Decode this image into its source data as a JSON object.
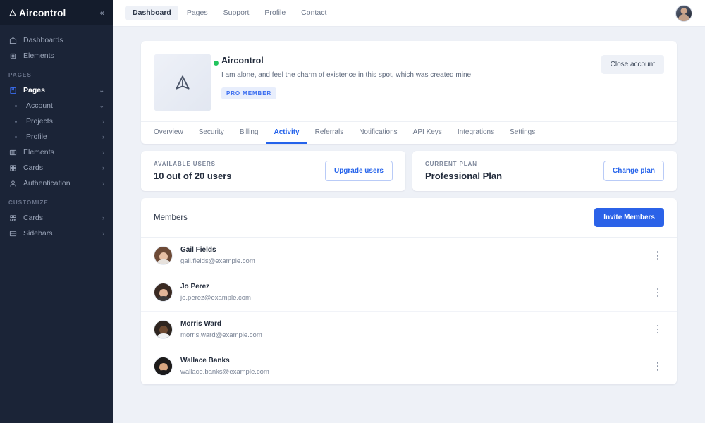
{
  "sidebar": {
    "brand": "Aircontrol",
    "collapse_icon": "chevron-double-left-icon",
    "top_items": [
      {
        "label": "Dashboards",
        "icon": "home-icon"
      },
      {
        "label": "Elements",
        "icon": "chip-icon"
      }
    ],
    "pages_section": "PAGES",
    "pages_items": [
      {
        "label": "Pages",
        "icon": "book-icon",
        "chevron": "⌄",
        "active": true,
        "sub": false
      },
      {
        "label": "Account",
        "icon": "bullet-dot",
        "chevron": "⌄",
        "active": false,
        "sub": true
      },
      {
        "label": "Projects",
        "icon": "bullet-dot",
        "chevron": "›",
        "active": false,
        "sub": true
      },
      {
        "label": "Profile",
        "icon": "bullet-dot",
        "chevron": "›",
        "active": false,
        "sub": true
      },
      {
        "label": "Elements",
        "icon": "columns-icon",
        "chevron": "›",
        "active": false,
        "sub": false
      },
      {
        "label": "Cards",
        "icon": "grid-icon",
        "chevron": "›",
        "active": false,
        "sub": false
      },
      {
        "label": "Authentication",
        "icon": "user-icon",
        "chevron": "›",
        "active": false,
        "sub": false
      }
    ],
    "customize_section": "CUSTOMIZE",
    "customize_items": [
      {
        "label": "Cards",
        "icon": "grid-plus-icon",
        "chevron": "›"
      },
      {
        "label": "Sidebars",
        "icon": "sidebar-icon",
        "chevron": "›"
      }
    ]
  },
  "topbar": {
    "nav": [
      {
        "label": "Dashboard",
        "active": true
      },
      {
        "label": "Pages",
        "active": false
      },
      {
        "label": "Support",
        "active": false
      },
      {
        "label": "Profile",
        "active": false
      },
      {
        "label": "Contact",
        "active": false
      }
    ],
    "avatar_name": "user-avatar"
  },
  "profile": {
    "logo_icon": "aircontrol-triangle-logo",
    "status": "online",
    "name": "Aircontrol",
    "description": "I am alone, and feel the charm of existence in this spot, which was created mine.",
    "badge": "PRO MEMBER",
    "close_button": "Close account",
    "tabs": [
      {
        "label": "Overview",
        "active": false
      },
      {
        "label": "Security",
        "active": false
      },
      {
        "label": "Billing",
        "active": false
      },
      {
        "label": "Activity",
        "active": true
      },
      {
        "label": "Referrals",
        "active": false
      },
      {
        "label": "Notifications",
        "active": false
      },
      {
        "label": "API Keys",
        "active": false
      },
      {
        "label": "Integrations",
        "active": false
      },
      {
        "label": "Settings",
        "active": false
      }
    ]
  },
  "stats": [
    {
      "label": "AVAILABLE USERS",
      "value": "10 out of 20 users",
      "button": "Upgrade users"
    },
    {
      "label": "CURRENT PLAN",
      "value": "Professional Plan",
      "button": "Change plan"
    }
  ],
  "members": {
    "title": "Members",
    "invite_button": "Invite Members",
    "menu_icon": "vertical-dots-icon",
    "list": [
      {
        "name": "Gail Fields",
        "email": "gail.fields@example.com",
        "hair": "#6d4a36",
        "face": "#e8c0a4",
        "body": "#e7e2dd"
      },
      {
        "name": "Jo Perez",
        "email": "jo.perez@example.com",
        "hair": "#3a2a22",
        "face": "#e3b698",
        "body": "#3c3a3a"
      },
      {
        "name": "Morris Ward",
        "email": "morris.ward@example.com",
        "hair": "#2e2520",
        "face": "#6d4a32",
        "body": "#f0f1f2"
      },
      {
        "name": "Wallace Banks",
        "email": "wallace.banks@example.com",
        "hair": "#1d1b1a",
        "face": "#d9a781",
        "body": "#1b1b1d"
      }
    ]
  },
  "colors": {
    "sidebar_bg": "#1b2437",
    "page_bg": "#eef1f7",
    "accent": "#2563eb",
    "primary_button": "#2b62e8",
    "status_green": "#22c55e"
  }
}
